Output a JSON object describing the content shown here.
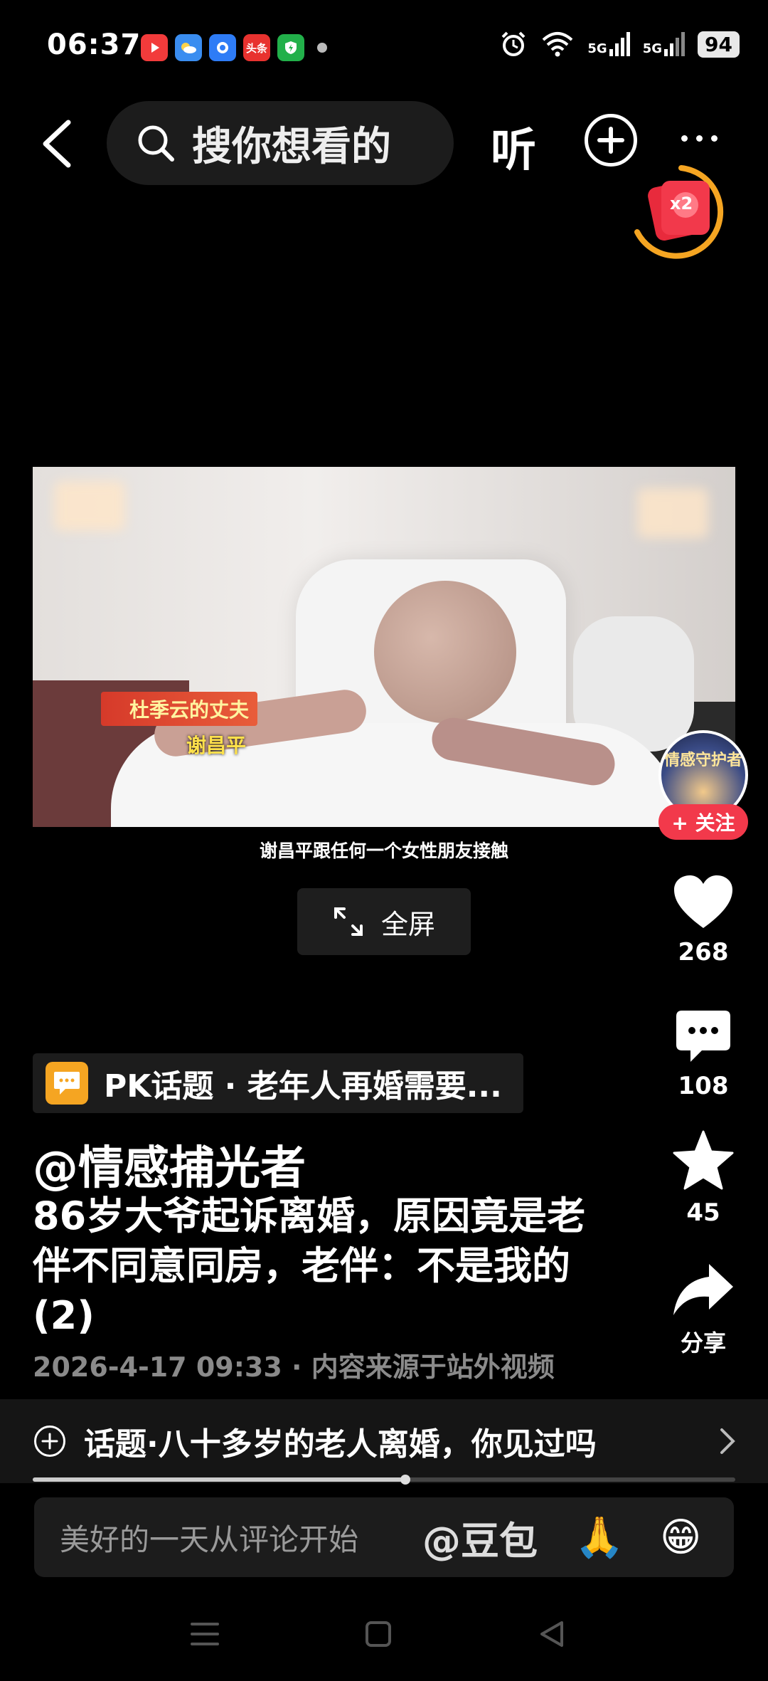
{
  "status_bar": {
    "time": "06:37",
    "battery": "94",
    "net1": "5G",
    "net2": "5G",
    "app_icons": [
      "video-app-icon",
      "weather-app-icon",
      "browser-app-icon",
      "toutiao-app-icon",
      "security-app-icon"
    ],
    "toutiao_label": "头条"
  },
  "top_bar": {
    "search_placeholder": "搜你想看的",
    "listen_label": "听"
  },
  "red_packet": {
    "multiplier": "x2"
  },
  "video": {
    "caption_name_title": "杜季云的丈夫",
    "caption_name": "谢昌平",
    "subtitle": "谢昌平跟任何一个女性朋友接触",
    "fullscreen_label": "全屏"
  },
  "avatar": {
    "text": "情感守护者",
    "follow_label": "+ 关注"
  },
  "actions": {
    "likes": "268",
    "comments": "108",
    "favorites": "45",
    "share_label": "分享"
  },
  "post": {
    "pk_topic": "PK话题 · 老年人再婚需要...",
    "author": "@情感捕光者",
    "description": "86岁大爷起诉离婚，原因竟是老伴不同意同房，老伴：不是我的 (2)",
    "meta": "2026-4-17 09:33 · 内容来源于站外视频",
    "topic": "话题·八十多岁的老人离婚，你见过吗"
  },
  "playback": {
    "progress_fraction": 0.53
  },
  "comment_bar": {
    "placeholder": "美好的一天从评论开始",
    "mention": "@豆包",
    "emoji1": "🙏",
    "emoji2": "😁"
  },
  "colors": {
    "background": "#000000",
    "follow_red": "#f2394b",
    "pk_orange": "#f5a522",
    "ring_orange": "#f5a522"
  }
}
